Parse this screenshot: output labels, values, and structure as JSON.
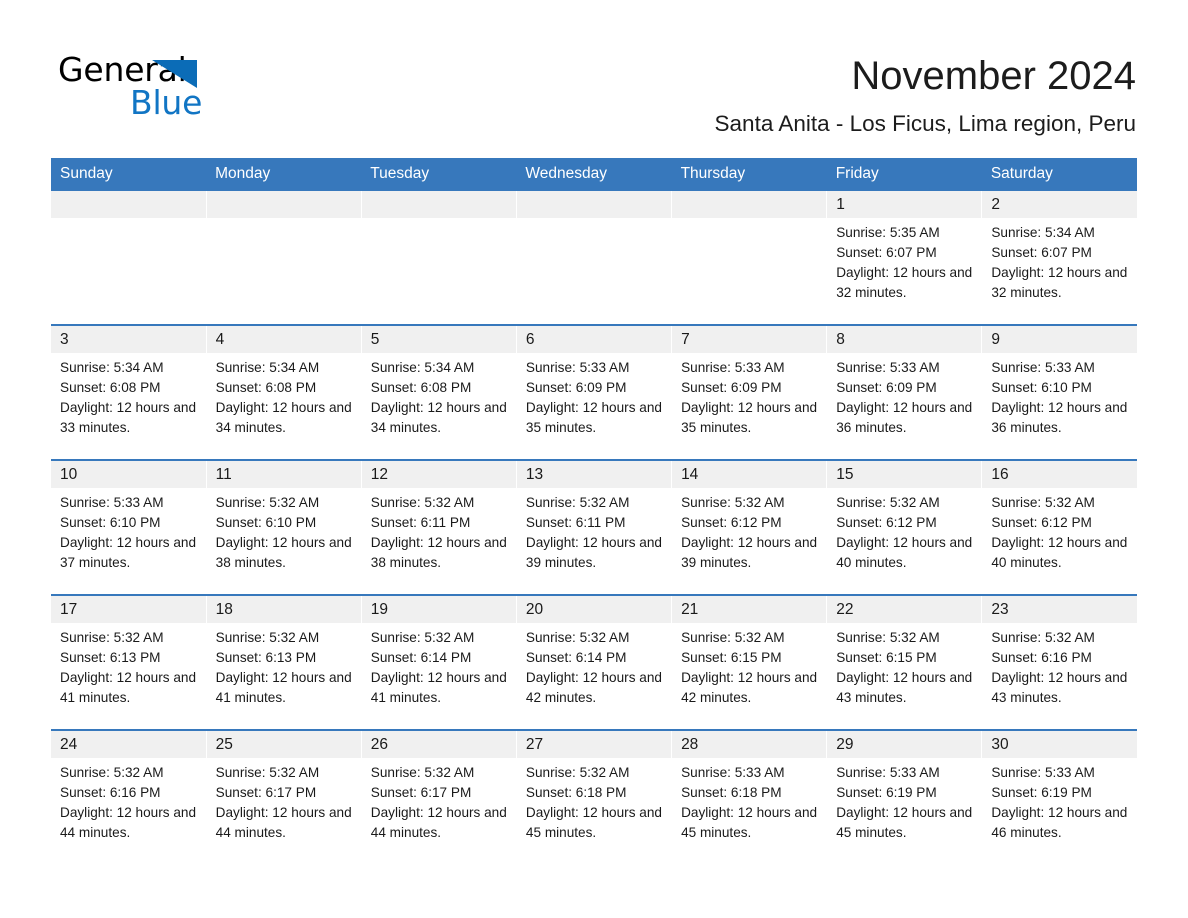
{
  "brand": {
    "name_part1": "General",
    "name_part2": "Blue",
    "accent_color": "#1175c4",
    "triangle_color": "#0b6cb7"
  },
  "header": {
    "month_title": "November 2024",
    "location": "Santa Anita - Los Ficus, Lima region, Peru",
    "header_bg_color": "#3778bc",
    "daynum_bg_color": "#f0f0f0"
  },
  "calendar": {
    "weekday_headers": [
      "Sunday",
      "Monday",
      "Tuesday",
      "Wednesday",
      "Thursday",
      "Friday",
      "Saturday"
    ],
    "weeks": [
      [
        {
          "day": "",
          "sunrise": "",
          "sunset": "",
          "daylight": ""
        },
        {
          "day": "",
          "sunrise": "",
          "sunset": "",
          "daylight": ""
        },
        {
          "day": "",
          "sunrise": "",
          "sunset": "",
          "daylight": ""
        },
        {
          "day": "",
          "sunrise": "",
          "sunset": "",
          "daylight": ""
        },
        {
          "day": "",
          "sunrise": "",
          "sunset": "",
          "daylight": ""
        },
        {
          "day": "1",
          "sunrise": "Sunrise: 5:35 AM",
          "sunset": "Sunset: 6:07 PM",
          "daylight": "Daylight: 12 hours and 32 minutes."
        },
        {
          "day": "2",
          "sunrise": "Sunrise: 5:34 AM",
          "sunset": "Sunset: 6:07 PM",
          "daylight": "Daylight: 12 hours and 32 minutes."
        }
      ],
      [
        {
          "day": "3",
          "sunrise": "Sunrise: 5:34 AM",
          "sunset": "Sunset: 6:08 PM",
          "daylight": "Daylight: 12 hours and 33 minutes."
        },
        {
          "day": "4",
          "sunrise": "Sunrise: 5:34 AM",
          "sunset": "Sunset: 6:08 PM",
          "daylight": "Daylight: 12 hours and 34 minutes."
        },
        {
          "day": "5",
          "sunrise": "Sunrise: 5:34 AM",
          "sunset": "Sunset: 6:08 PM",
          "daylight": "Daylight: 12 hours and 34 minutes."
        },
        {
          "day": "6",
          "sunrise": "Sunrise: 5:33 AM",
          "sunset": "Sunset: 6:09 PM",
          "daylight": "Daylight: 12 hours and 35 minutes."
        },
        {
          "day": "7",
          "sunrise": "Sunrise: 5:33 AM",
          "sunset": "Sunset: 6:09 PM",
          "daylight": "Daylight: 12 hours and 35 minutes."
        },
        {
          "day": "8",
          "sunrise": "Sunrise: 5:33 AM",
          "sunset": "Sunset: 6:09 PM",
          "daylight": "Daylight: 12 hours and 36 minutes."
        },
        {
          "day": "9",
          "sunrise": "Sunrise: 5:33 AM",
          "sunset": "Sunset: 6:10 PM",
          "daylight": "Daylight: 12 hours and 36 minutes."
        }
      ],
      [
        {
          "day": "10",
          "sunrise": "Sunrise: 5:33 AM",
          "sunset": "Sunset: 6:10 PM",
          "daylight": "Daylight: 12 hours and 37 minutes."
        },
        {
          "day": "11",
          "sunrise": "Sunrise: 5:32 AM",
          "sunset": "Sunset: 6:10 PM",
          "daylight": "Daylight: 12 hours and 38 minutes."
        },
        {
          "day": "12",
          "sunrise": "Sunrise: 5:32 AM",
          "sunset": "Sunset: 6:11 PM",
          "daylight": "Daylight: 12 hours and 38 minutes."
        },
        {
          "day": "13",
          "sunrise": "Sunrise: 5:32 AM",
          "sunset": "Sunset: 6:11 PM",
          "daylight": "Daylight: 12 hours and 39 minutes."
        },
        {
          "day": "14",
          "sunrise": "Sunrise: 5:32 AM",
          "sunset": "Sunset: 6:12 PM",
          "daylight": "Daylight: 12 hours and 39 minutes."
        },
        {
          "day": "15",
          "sunrise": "Sunrise: 5:32 AM",
          "sunset": "Sunset: 6:12 PM",
          "daylight": "Daylight: 12 hours and 40 minutes."
        },
        {
          "day": "16",
          "sunrise": "Sunrise: 5:32 AM",
          "sunset": "Sunset: 6:12 PM",
          "daylight": "Daylight: 12 hours and 40 minutes."
        }
      ],
      [
        {
          "day": "17",
          "sunrise": "Sunrise: 5:32 AM",
          "sunset": "Sunset: 6:13 PM",
          "daylight": "Daylight: 12 hours and 41 minutes."
        },
        {
          "day": "18",
          "sunrise": "Sunrise: 5:32 AM",
          "sunset": "Sunset: 6:13 PM",
          "daylight": "Daylight: 12 hours and 41 minutes."
        },
        {
          "day": "19",
          "sunrise": "Sunrise: 5:32 AM",
          "sunset": "Sunset: 6:14 PM",
          "daylight": "Daylight: 12 hours and 41 minutes."
        },
        {
          "day": "20",
          "sunrise": "Sunrise: 5:32 AM",
          "sunset": "Sunset: 6:14 PM",
          "daylight": "Daylight: 12 hours and 42 minutes."
        },
        {
          "day": "21",
          "sunrise": "Sunrise: 5:32 AM",
          "sunset": "Sunset: 6:15 PM",
          "daylight": "Daylight: 12 hours and 42 minutes."
        },
        {
          "day": "22",
          "sunrise": "Sunrise: 5:32 AM",
          "sunset": "Sunset: 6:15 PM",
          "daylight": "Daylight: 12 hours and 43 minutes."
        },
        {
          "day": "23",
          "sunrise": "Sunrise: 5:32 AM",
          "sunset": "Sunset: 6:16 PM",
          "daylight": "Daylight: 12 hours and 43 minutes."
        }
      ],
      [
        {
          "day": "24",
          "sunrise": "Sunrise: 5:32 AM",
          "sunset": "Sunset: 6:16 PM",
          "daylight": "Daylight: 12 hours and 44 minutes."
        },
        {
          "day": "25",
          "sunrise": "Sunrise: 5:32 AM",
          "sunset": "Sunset: 6:17 PM",
          "daylight": "Daylight: 12 hours and 44 minutes."
        },
        {
          "day": "26",
          "sunrise": "Sunrise: 5:32 AM",
          "sunset": "Sunset: 6:17 PM",
          "daylight": "Daylight: 12 hours and 44 minutes."
        },
        {
          "day": "27",
          "sunrise": "Sunrise: 5:32 AM",
          "sunset": "Sunset: 6:18 PM",
          "daylight": "Daylight: 12 hours and 45 minutes."
        },
        {
          "day": "28",
          "sunrise": "Sunrise: 5:33 AM",
          "sunset": "Sunset: 6:18 PM",
          "daylight": "Daylight: 12 hours and 45 minutes."
        },
        {
          "day": "29",
          "sunrise": "Sunrise: 5:33 AM",
          "sunset": "Sunset: 6:19 PM",
          "daylight": "Daylight: 12 hours and 45 minutes."
        },
        {
          "day": "30",
          "sunrise": "Sunrise: 5:33 AM",
          "sunset": "Sunset: 6:19 PM",
          "daylight": "Daylight: 12 hours and 46 minutes."
        }
      ]
    ]
  }
}
